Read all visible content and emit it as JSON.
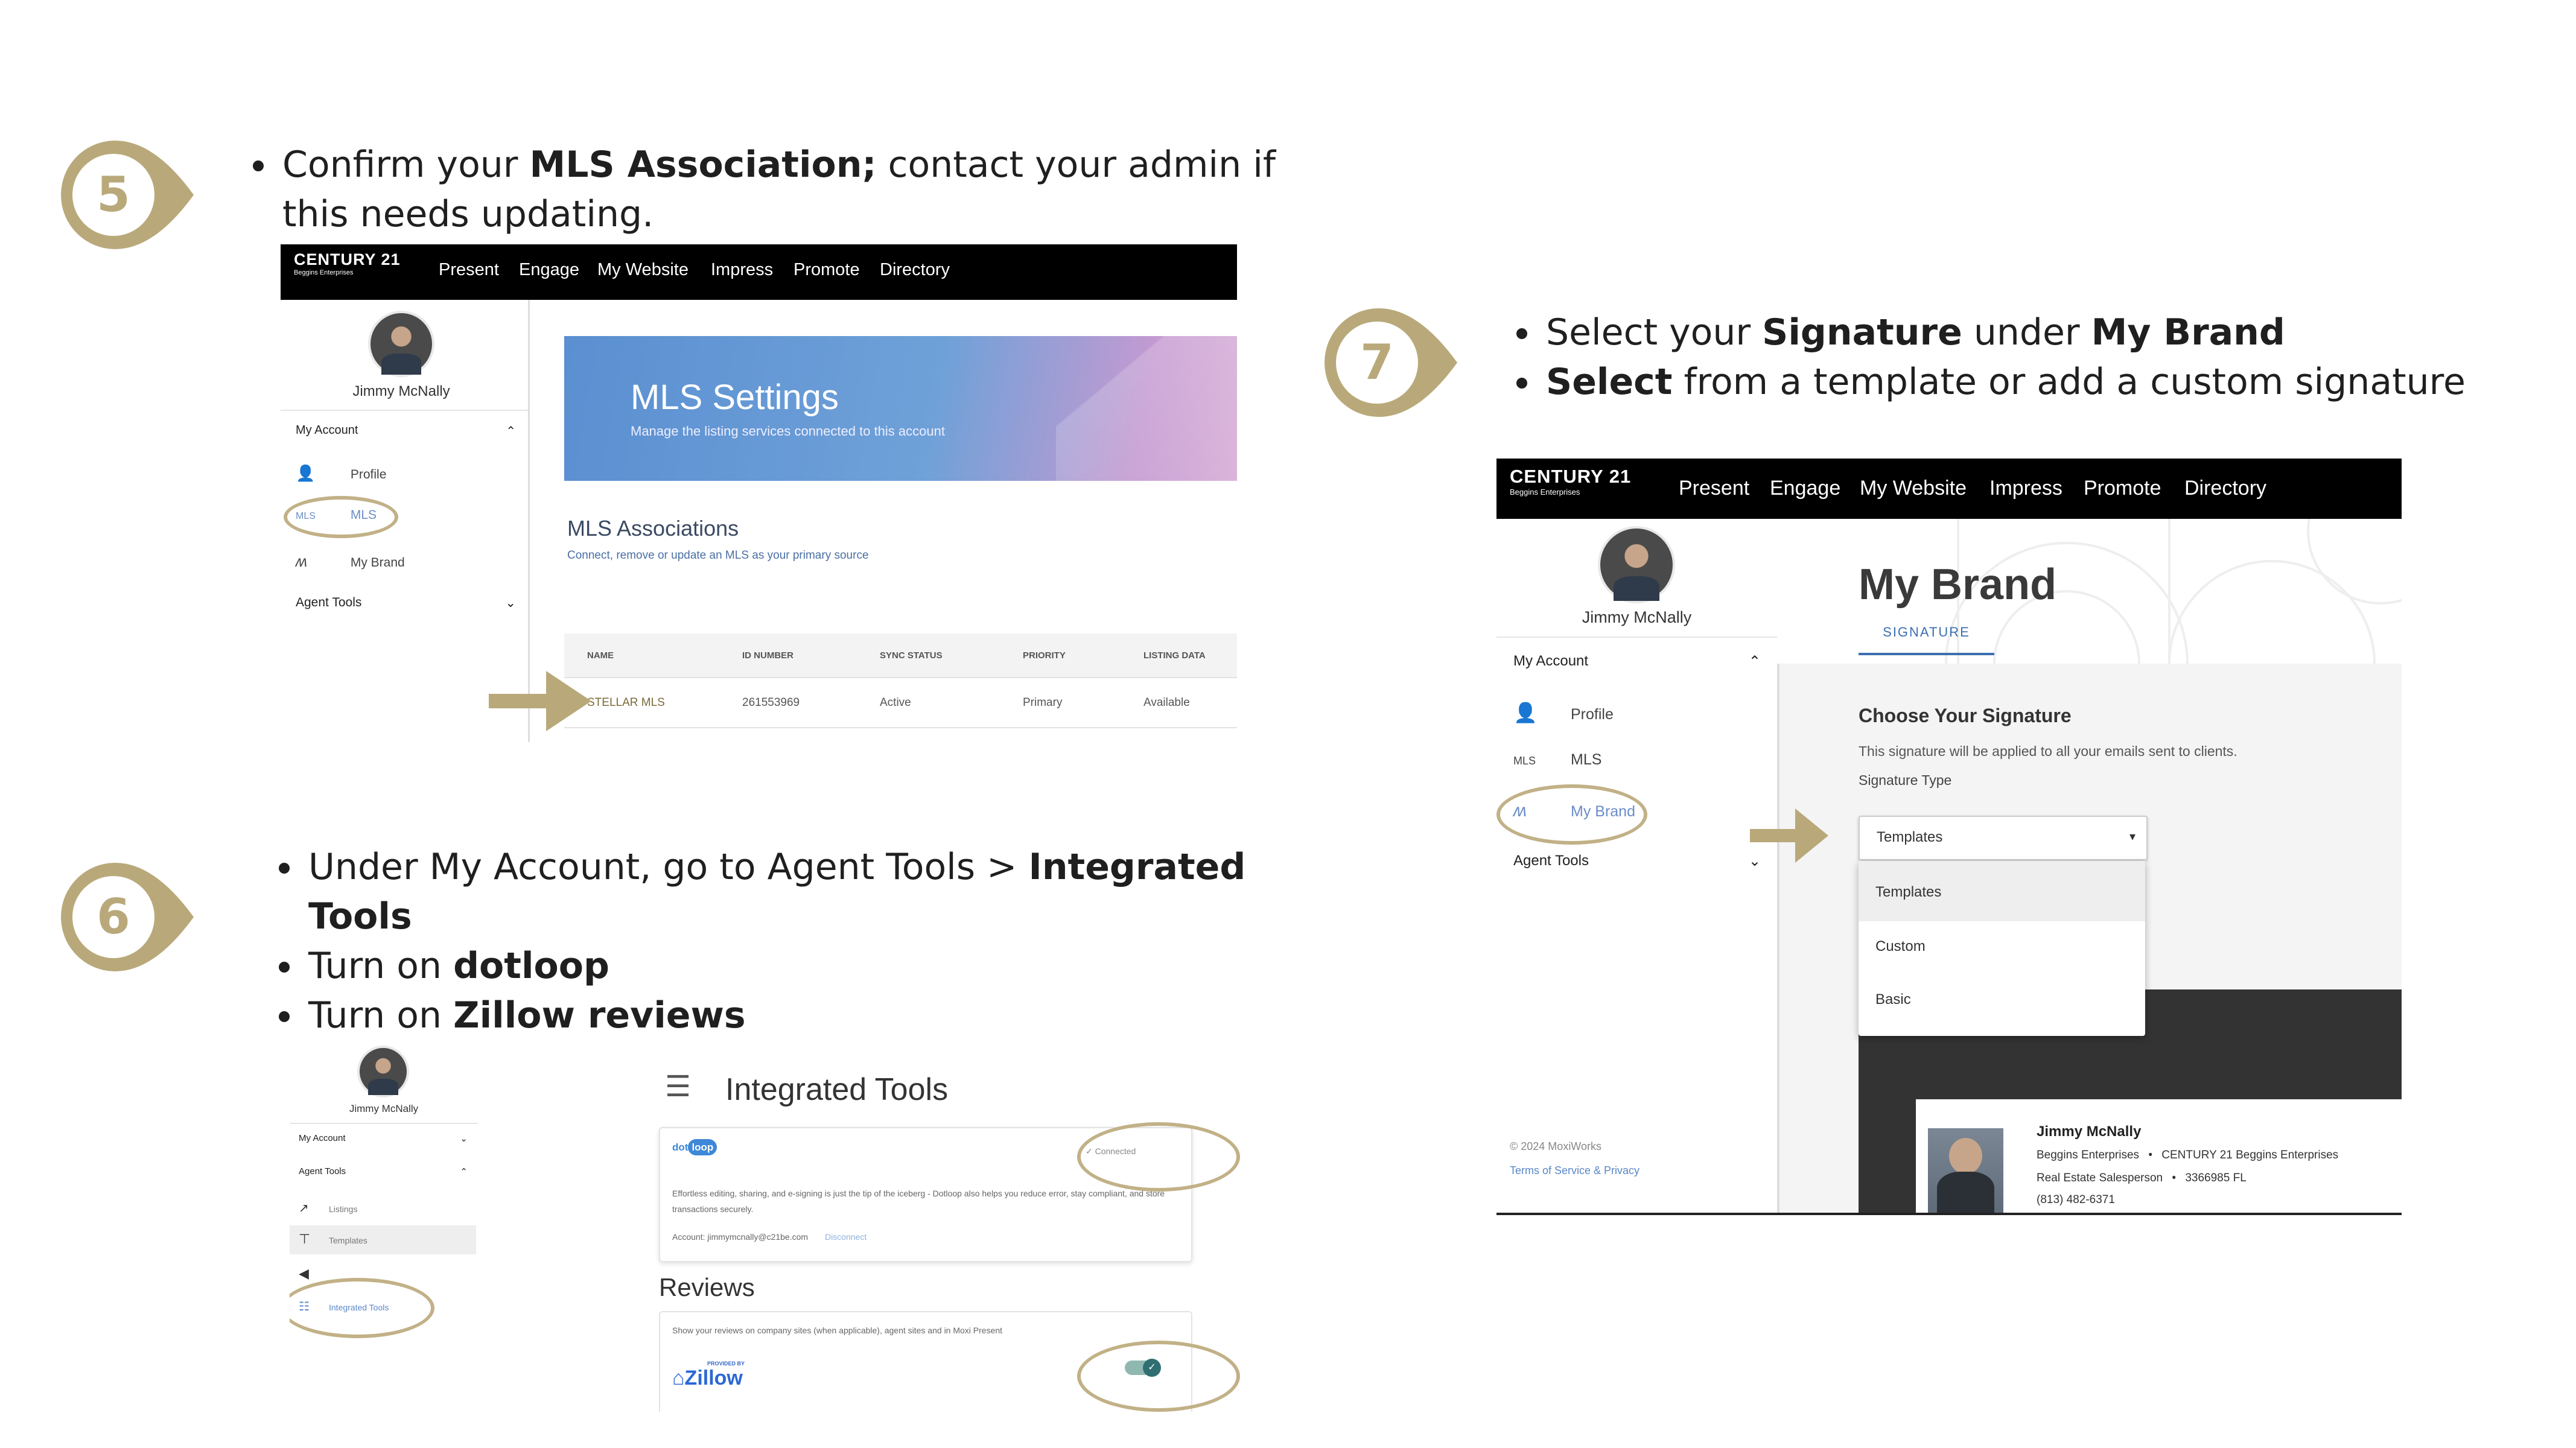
{
  "steps": {
    "s5": {
      "number": "5",
      "bullet1": {
        "pre": "Confirm your ",
        "bold": "MLS Association;",
        "post": " contact your admin if this needs updating."
      }
    },
    "s6": {
      "number": "6",
      "bullet1": {
        "pre": "Under My Account, go to Agent Tools > ",
        "bold": "Integrated Tools"
      },
      "bullet2": {
        "pre": "Turn on ",
        "bold": "dotloop"
      },
      "bullet3": {
        "pre": "Turn on ",
        "bold": "Zillow reviews"
      }
    },
    "s7": {
      "number": "7",
      "bullet1": {
        "pre": "Select your ",
        "bold1": "Signature",
        "mid": " under ",
        "bold2": "My Brand"
      },
      "bullet2": {
        "bold": "Select",
        "post": " from a template or add a custom signature"
      }
    }
  },
  "nav": {
    "logo": "CENTURY 21",
    "logo_sub": "Beggins Enterprises",
    "items": [
      "Present",
      "Engage",
      "My Website",
      "Impress",
      "Promote",
      "Directory"
    ]
  },
  "user": {
    "name": "Jimmy McNally"
  },
  "sidebar": {
    "my_account": "My Account",
    "profile": "Profile",
    "mls_icon": "MLS",
    "mls": "MLS",
    "my_brand": "My Brand",
    "agent_tools": "Agent Tools",
    "listings": "Listings",
    "templates": "Templates",
    "integrated_tools": "Integrated Tools",
    "footer_copy": "© 2024 MoxiWorks",
    "footer_terms": "Terms of Service & Privacy"
  },
  "mls_page": {
    "banner_title": "MLS Settings",
    "banner_sub": "Manage the listing services connected to this account",
    "section_title": "MLS Associations",
    "section_sub": "Connect, remove or update an MLS as your primary source",
    "columns": [
      "NAME",
      "ID NUMBER",
      "SYNC STATUS",
      "PRIORITY",
      "LISTING DATA"
    ],
    "row": [
      "STELLAR MLS",
      "261553969",
      "Active",
      "Primary",
      "Available"
    ]
  },
  "tools_page": {
    "title": "Integrated Tools",
    "dotloop_logo": {
      "a": "dot",
      "b": "loop"
    },
    "connected": "Connected",
    "dotloop_desc": "Effortless editing, sharing, and e-signing is just the tip of the iceberg - Dotloop also helps you reduce error, stay compliant, and store transactions securely.",
    "account_label": "Account: jimmymcnally@c21be.com",
    "disconnect": "Disconnect",
    "reviews_title": "Reviews",
    "reviews_desc": "Show your reviews on company sites (when applicable), agent sites and in Moxi Present",
    "provided_by": "PROVIDED BY",
    "zillow": "Zillow"
  },
  "brand_page": {
    "title": "My Brand",
    "tab": "SIGNATURE",
    "choose": "Choose Your Signature",
    "desc": "This signature will be applied to all your emails sent to clients.",
    "type_label": "Signature Type",
    "selected": "Templates",
    "options": [
      "Templates",
      "Custom",
      "Basic"
    ],
    "sig_name": "Jimmy McNally",
    "sig_line1a": "Beggins Enterprises",
    "sig_line1b": "CENTURY 21 Beggins Enterprises",
    "sig_line2a": "Real Estate Salesperson",
    "sig_line2b": "3366985 FL",
    "sig_line3": "(813) 482-6371"
  },
  "colors": {
    "accent_gold": "#c2b187",
    "badge_ring": "#b9a97a",
    "nav_black": "#000000",
    "link_blue": "#3b6fb0"
  }
}
